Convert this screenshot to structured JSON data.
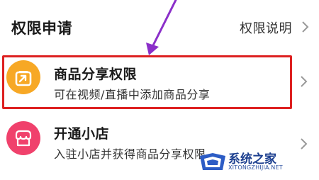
{
  "header": {
    "title": "权限申请",
    "explain_link": "权限说明"
  },
  "rows": [
    {
      "title": "商品分享权限",
      "description": "可在视频/直播中添加商品分享",
      "icon": "share-arrow-box-icon",
      "icon_color": "#f7a825",
      "highlighted": true
    },
    {
      "title": "开通小店",
      "description": "入驻小店并获得商品分享权限",
      "icon": "shop-awning-icon",
      "icon_color": "#f0416c",
      "highlighted": false
    }
  ],
  "annotation": {
    "arrow_color": "#8b2fc9"
  },
  "watermark": {
    "title": "系统之家",
    "domain": "XITONGZHIJIA.NET"
  },
  "colors": {
    "highlight_border": "#dd2020",
    "chevron": "#9a9a9a"
  }
}
